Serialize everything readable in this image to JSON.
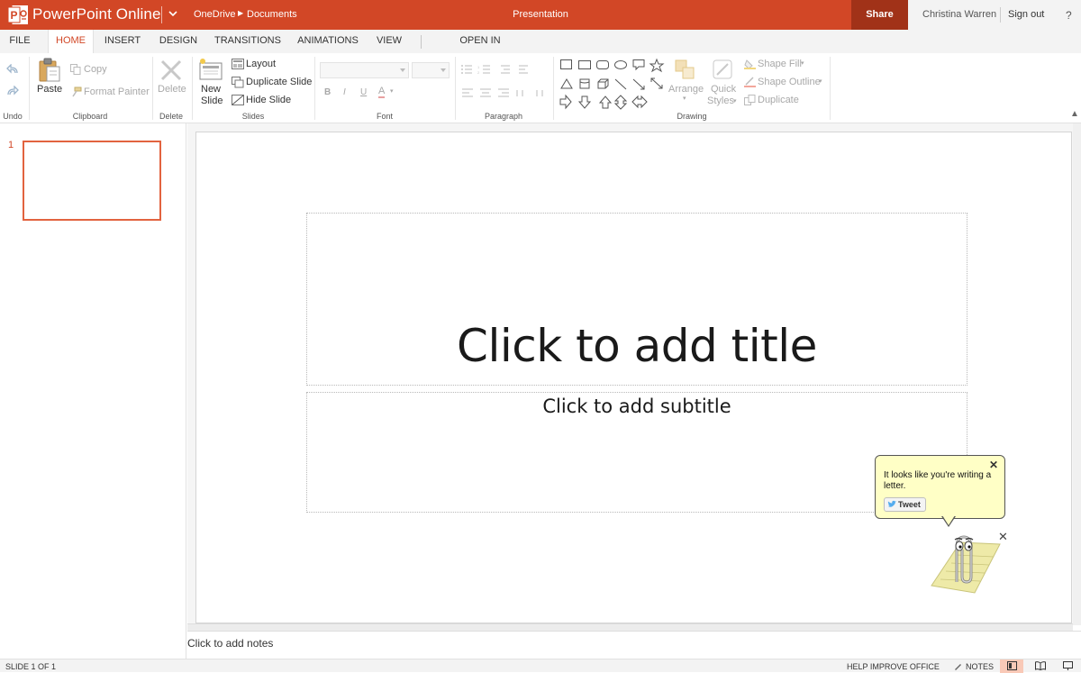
{
  "app": {
    "name": "PowerPoint Online",
    "document_title": "Presentation"
  },
  "breadcrumb": {
    "root": "OneDrive",
    "folder": "Documents"
  },
  "header": {
    "share_label": "Share",
    "user_name": "Christina Warren",
    "sign_out_label": "Sign out",
    "help_label": "?"
  },
  "tabs": [
    "FILE",
    "HOME",
    "INSERT",
    "DESIGN",
    "TRANSITIONS",
    "ANIMATIONS",
    "VIEW",
    "OPEN IN POWERPOINT"
  ],
  "active_tab": "HOME",
  "ribbon": {
    "undo_group": "Undo",
    "clipboard": {
      "label": "Clipboard",
      "paste": "Paste",
      "copy": "Copy",
      "format_painter": "Format Painter"
    },
    "delete": {
      "label": "Delete",
      "button": "Delete"
    },
    "slides": {
      "label": "Slides",
      "new_slide_line1": "New",
      "new_slide_line2": "Slide",
      "layout": "Layout",
      "duplicate_slide": "Duplicate Slide",
      "hide_slide": "Hide Slide"
    },
    "font": {
      "label": "Font",
      "bold": "B",
      "italic": "I",
      "underline": "U",
      "font_color": "A"
    },
    "paragraph": {
      "label": "Paragraph"
    },
    "drawing": {
      "label": "Drawing",
      "arrange": "Arrange",
      "quick_styles_line1": "Quick",
      "quick_styles_line2": "Styles",
      "shape_fill": "Shape Fill",
      "shape_outline": "Shape Outline",
      "duplicate": "Duplicate"
    }
  },
  "thumbnails": [
    {
      "number": "1"
    }
  ],
  "slide": {
    "title_placeholder": "Click to add title",
    "subtitle_placeholder": "Click to add subtitle"
  },
  "notes": {
    "placeholder": "Click to add notes"
  },
  "clippy": {
    "message": "It looks like you're writing a letter.",
    "tweet_label": "Tweet"
  },
  "status": {
    "slide_counter": "SLIDE 1 OF 1",
    "help_improve": "HELP IMPROVE OFFICE",
    "notes_label": "NOTES"
  },
  "colors": {
    "accent": "#d24726",
    "share_bg": "#a13218",
    "selection": "#e2633f",
    "bubble_bg": "#ffffc6"
  }
}
